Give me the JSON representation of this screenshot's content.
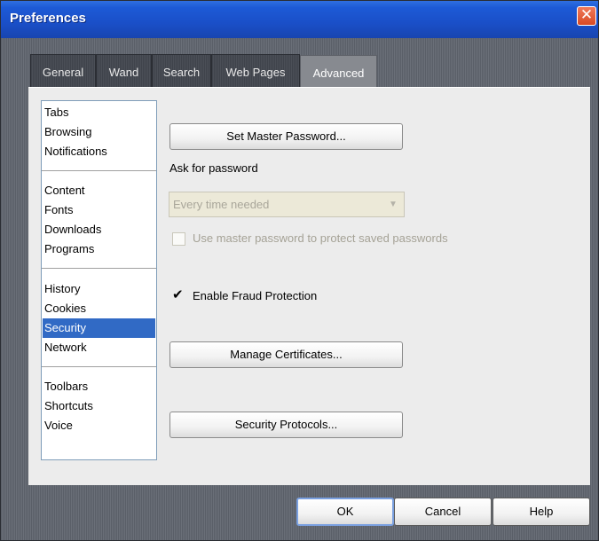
{
  "window": {
    "title": "Preferences",
    "close_symbol": "✕"
  },
  "tabs": [
    {
      "label": "General"
    },
    {
      "label": "Wand"
    },
    {
      "label": "Search"
    },
    {
      "label": "Web Pages"
    },
    {
      "label": "Advanced",
      "active": true
    }
  ],
  "categories": {
    "group1": [
      "Tabs",
      "Browsing",
      "Notifications"
    ],
    "group2": [
      "Content",
      "Fonts",
      "Downloads",
      "Programs"
    ],
    "group3": [
      "History",
      "Cookies",
      "Security",
      "Network"
    ],
    "group4": [
      "Toolbars",
      "Shortcuts",
      "Voice"
    ],
    "selected": "Security"
  },
  "security": {
    "master_password_button": "Set Master Password...",
    "ask_for_password_label": "Ask for password",
    "ask_for_password_value": "Every time needed",
    "use_master_password_label": "Use master password to protect saved passwords",
    "use_master_password_checked": false,
    "fraud_protection_label": "Enable Fraud Protection",
    "fraud_protection_checked": true,
    "manage_certificates_button": "Manage Certificates...",
    "security_protocols_button": "Security Protocols..."
  },
  "dialog_buttons": {
    "ok": "OK",
    "cancel": "Cancel",
    "help": "Help"
  },
  "icons": {
    "close": "close-icon",
    "dropdown": "chevron-down-icon",
    "check": "check-icon"
  },
  "colors": {
    "titlebar": "#1d5ad6",
    "selection": "#316ac5",
    "close_button": "#d84a25"
  }
}
